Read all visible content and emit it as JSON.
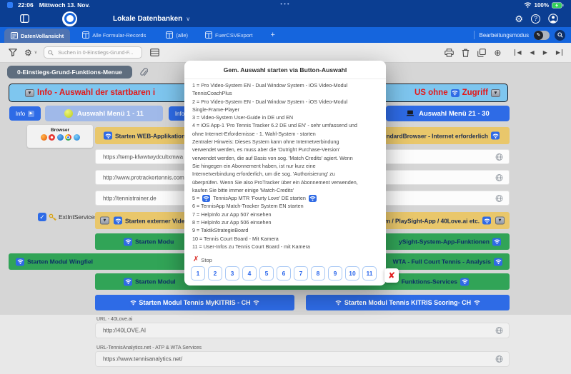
{
  "colors": {
    "accent_blue": "#2e6be6",
    "tab_blue": "#1565dd",
    "navy": "#0b3e92",
    "green": "#31a457",
    "yellow": "#e9c76b",
    "info_blue": "#7ec6ef",
    "red_text": "#e51717",
    "battery_green": "#30d158"
  },
  "icons": {
    "down": "▼",
    "play": "▶",
    "back": "◀",
    "fwd": "▶",
    "plus_circle": "⊕",
    "help": "?",
    "gear": "⚙",
    "close": "✘",
    "stop": "✗",
    "check": "✓",
    "pencil": "✎",
    "chevron": "∨",
    "dots": "•••"
  },
  "status_bar": {
    "time": "22:06",
    "date": "Mittwoch 13. Nov.",
    "battery": "100%"
  },
  "nav_bar": {
    "title": "Lokale Datenbanken"
  },
  "tab_bar": {
    "tabs": [
      {
        "label": "DatenVollansicht"
      },
      {
        "label": "Alle Formular-Records"
      },
      {
        "label": "(alle)"
      },
      {
        "label": "FuerCSVExport"
      }
    ],
    "add_label": "+",
    "edit_mode_label": "Bearbeitungsmodus"
  },
  "toolbar": {
    "search_placeholder": "Suchen in 0-Einstiegs-Grund-F..."
  },
  "breadcrumb": {
    "label": "0-Einstiegs-Grund-Funktions-Menue"
  },
  "content": {
    "info_header": {
      "left": "[[down]] Info - Auswahl der startbaren i",
      "right": "US ohne [[wifi]] Zugriff [[down]]"
    },
    "info_button_1": "Info",
    "info_button_2": "Info",
    "menu_1_11": "Auswahl Menü 1 - 11",
    "menu_21_30": "Auswahl Menü 21 - 30",
    "browser_label": "Browser",
    "web_header": {
      "left": "[[wifi]] Starten WEB-Applikation",
      "right": "ndardBrowser - Internet erforderlich [[wifi]]"
    },
    "url_fields": [
      "https://temp-kfwwtwydcultxmwa",
      "http://www.protrackertennis.com",
      "http://tennistrainer.de"
    ],
    "checkbox_label": "ExtIntServicesOnOff",
    "ext_video_header": {
      "left": "[[down]] [[wifi]] Starten externer Video-Se",
      "right": "sh.com / PlaySight-App / 40Love.ai etc. [[wifi]] [[down]]"
    },
    "green_rows": [
      {
        "left": "[[wifi]] Starten Modu",
        "right": "ySight-System-App-Funktionen [[wifi]]"
      },
      {
        "left": "[[wifi]] Starten Modul Wingfiel",
        "right": "WTA - Full Court Tennis - Analysis [[wifi]]"
      },
      {
        "left": "[[wifi]] Starten Modul",
        "right": "Funktions-Services [[wifi]]"
      }
    ],
    "blue_buttons": [
      "[[wifi]] Starten Modul Tennis MyKITRIS - CH [[wifi]]",
      "[[wifi]] Starten Modul Tennis KITRIS Scoring- CH [[wifi]]"
    ],
    "bottom_fields": [
      {
        "label": "URL - 40Love.ai",
        "value": "http://40LOVE.AI"
      },
      {
        "label": "URL-TennisAnalytics.net - ATP & WTA Services",
        "value": "https://www.tennisanalytics.net/"
      }
    ]
  },
  "dialog": {
    "title": "Gem. Auswahl starten via Button-Auswahl",
    "lines": [
      "1 = Pro Video-System EN - Dual Window System - iOS Video-Modul",
      "TennisCoachPlus",
      "2 = Pro Video-System EN - Dual Window System - iOS Video-Modul",
      "Single-Frame-Player",
      "3 = Video-System User-Guide in DE und EN",
      "4 = iOS App-1 'Pro Tennis Tracker 6.2 DE und EN' - sehr umfassend und",
      "ohne Internet-Erfordernisse - 1. Wahl-System - starten",
      "Zentraler Hinweis: Dieses System kann ohne Internetverbindung",
      "verwendet werden, es muss aber die 'Outright Purchase-Version'",
      "verwendet werden, die auf Basis von sog. 'Match Credits' agiert. Wenn",
      "Sie hingegen ein Abonnement haben, ist nur kurz eine",
      "Internetverbindung erforderlich, um die sog. 'Authorisierung' zu",
      "überprüfen. Wenn Sie also ProTracker über ein Abonnement verwenden,",
      "kaufen Sie bitte immer einige 'Match-Credits'",
      "5 = [[wifi]] TennisApp MTR 'Fourty Love' DE starten [[wifi]]",
      "6 = TennisApp Match-Tracker System EN starten",
      "7 = HelpInfo zur App 507 einsehen",
      "8 = HelpInfo zur App 506 einsehen",
      "9 = TaktikStrategieBoard",
      "10 = Tennis Court Board - Mit Kamera",
      "11 = User-Infos zu Tennis Court Board - mit Kamera"
    ],
    "stop_label": "Stop",
    "buttons": [
      "1",
      "2",
      "3",
      "4",
      "5",
      "6",
      "7",
      "8",
      "9",
      "10",
      "11"
    ]
  }
}
